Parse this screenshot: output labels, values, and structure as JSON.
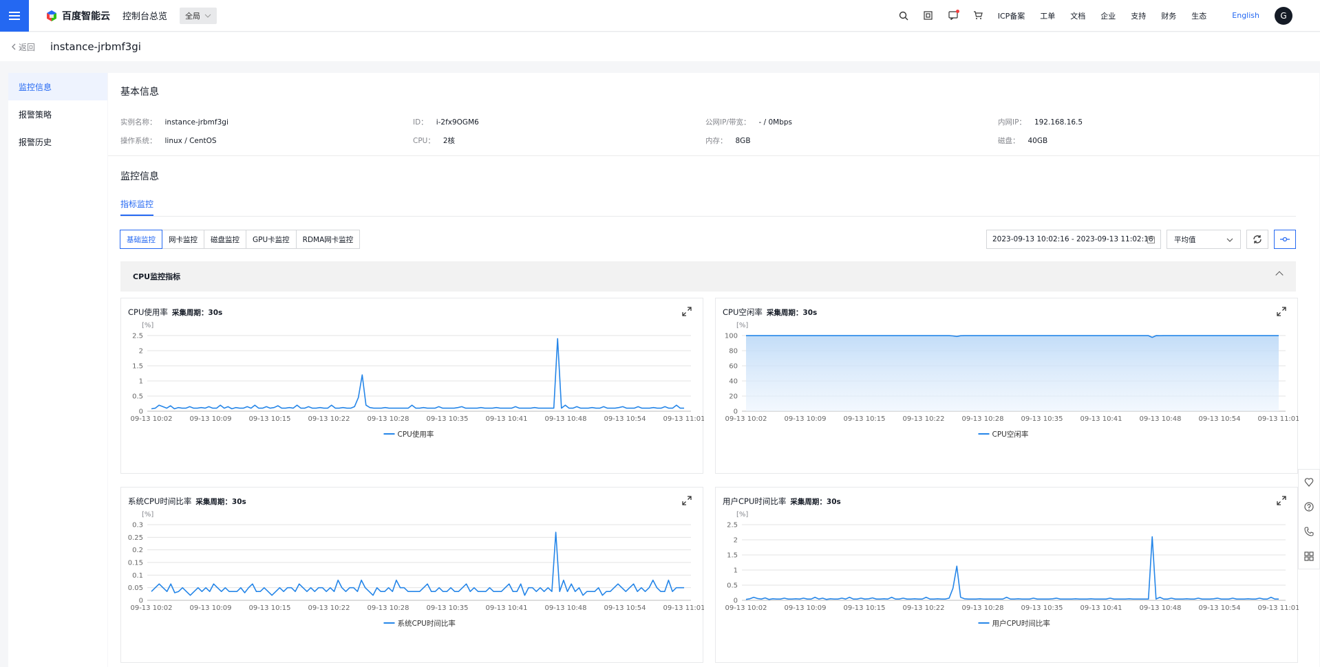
{
  "header": {
    "brand": "百度智能云",
    "console": "控制台总览",
    "region": "全局",
    "links": [
      "ICP备案",
      "工单",
      "文档",
      "企业",
      "支持",
      "财务",
      "生态"
    ],
    "language": "English",
    "avatar_letter": "G"
  },
  "subbar": {
    "back": "返回",
    "instance_name": "instance-jrbmf3gi"
  },
  "sidebar": {
    "items": [
      "监控信息",
      "报警策略",
      "报警历史"
    ]
  },
  "basic": {
    "title": "基本信息",
    "row1": [
      {
        "k": "实例名称：",
        "v": "instance-jrbmf3gi"
      },
      {
        "k": "ID：",
        "v": "i-2fx9OGM6"
      },
      {
        "k": "公网IP/带宽：",
        "v": "- / 0Mbps"
      },
      {
        "k": "内网IP：",
        "v": "192.168.16.5"
      }
    ],
    "row2": [
      {
        "k": "操作系统：",
        "v": "linux / CentOS"
      },
      {
        "k": "CPU：",
        "v": "2核"
      },
      {
        "k": "内存：",
        "v": "8GB"
      },
      {
        "k": "磁盘：",
        "v": "40GB"
      }
    ]
  },
  "monitor": {
    "title": "监控信息",
    "tab": "指标监控",
    "buttons": [
      "基础监控",
      "网卡监控",
      "磁盘监控",
      "GPU卡监控",
      "RDMA网卡监控"
    ],
    "date_range": "2023-09-13 10:02:16 - 2023-09-13 11:02:16",
    "aggregate": "平均值",
    "group_title": "CPU监控指标"
  },
  "chart_data": [
    {
      "type": "line",
      "title": "CPU使用率",
      "period_label": "采集周期：30s",
      "unit": "[%]",
      "legend": "CPU使用率",
      "ylim": [
        0,
        2.5
      ],
      "yticks": [
        "0",
        "0.5",
        "1",
        "1.5",
        "2",
        "2.5"
      ],
      "xticks": [
        "09-13 10:02",
        "09-13 10:09",
        "09-13 10:15",
        "09-13 10:22",
        "09-13 10:28",
        "09-13 10:35",
        "09-13 10:41",
        "09-13 10:48",
        "09-13 10:54",
        "09-13 11:01"
      ],
      "area": false,
      "values": [
        0.08,
        0.1,
        0.2,
        0.15,
        0.1,
        0.18,
        0.08,
        0.12,
        0.1,
        0.1,
        0.15,
        0.1,
        0.1,
        0.12,
        0.1,
        0.15,
        0.1,
        0.1,
        0.2,
        0.1,
        0.15,
        0.08,
        0.12,
        0.1,
        0.1,
        0.15,
        0.1,
        0.2,
        0.1,
        0.1,
        0.15,
        0.1,
        0.12,
        0.18,
        0.1,
        0.1,
        0.12,
        0.1,
        0.2,
        0.1,
        0.1,
        0.15,
        0.1,
        0.1,
        0.12,
        0.1,
        0.1,
        0.2,
        0.1,
        0.1,
        0.12,
        0.1,
        0.1,
        0.15,
        0.45,
        1.2,
        0.2,
        0.12,
        0.1,
        0.1,
        0.1,
        0.12,
        0.1,
        0.1,
        0.1,
        0.1,
        0.1,
        0.1,
        0.2,
        0.1,
        0.1,
        0.12,
        0.1,
        0.1,
        0.1,
        0.15,
        0.1,
        0.1,
        0.1,
        0.1,
        0.12,
        0.15,
        0.1,
        0.1,
        0.1,
        0.1,
        0.12,
        0.1,
        0.1,
        0.1,
        0.12,
        0.1,
        0.1,
        0.1,
        0.1,
        0.15,
        0.1,
        0.1,
        0.1,
        0.1,
        0.12,
        0.1,
        0.1,
        0.1,
        0.1,
        0.1,
        2.4,
        0.1,
        0.2,
        0.1,
        0.1,
        0.15,
        0.1,
        0.1,
        0.1,
        0.12,
        0.1,
        0.1,
        0.15,
        0.1,
        0.1,
        0.1,
        0.12,
        0.15,
        0.1,
        0.1,
        0.1,
        0.15,
        0.1,
        0.1,
        0.1,
        0.12,
        0.1,
        0.1,
        0.15,
        0.1,
        0.1,
        0.2,
        0.1,
        0.1
      ]
    },
    {
      "type": "area",
      "title": "CPU空闲率",
      "period_label": "采集周期：30s",
      "unit": "[%]",
      "legend": "CPU空闲率",
      "ylim": [
        0,
        100
      ],
      "yticks": [
        "0",
        "20",
        "40",
        "60",
        "80",
        "100"
      ],
      "xticks": [
        "09-13 10:02",
        "09-13 10:09",
        "09-13 10:15",
        "09-13 10:22",
        "09-13 10:28",
        "09-13 10:35",
        "09-13 10:41",
        "09-13 10:48",
        "09-13 10:54",
        "09-13 11:01"
      ],
      "area": true,
      "values": [
        99.9,
        99.9,
        99.9,
        99.9,
        99.9,
        99.9,
        99.9,
        99.9,
        99.9,
        99.9,
        99.9,
        99.9,
        99.9,
        99.9,
        99.9,
        99.9,
        99.9,
        99.9,
        99.9,
        99.9,
        99.9,
        99.9,
        99.9,
        99.9,
        99.9,
        99.9,
        99.9,
        99.9,
        99.9,
        99.9,
        99.9,
        99.9,
        99.9,
        99.9,
        99.9,
        99.9,
        99.9,
        99.9,
        99.9,
        99.9,
        99.9,
        99.9,
        99.9,
        99.9,
        99.9,
        99.9,
        99.9,
        99.9,
        99.9,
        99.9,
        99.9,
        99.9,
        99.9,
        99.9,
        99.5,
        98.8,
        99.8,
        99.9,
        99.9,
        99.9,
        99.9,
        99.9,
        99.9,
        99.9,
        99.9,
        99.9,
        99.9,
        99.9,
        99.9,
        99.9,
        99.9,
        99.9,
        99.9,
        99.9,
        99.9,
        99.9,
        99.9,
        99.9,
        99.9,
        99.9,
        99.9,
        99.9,
        99.9,
        99.9,
        99.9,
        99.9,
        99.9,
        99.9,
        99.9,
        99.9,
        99.9,
        99.9,
        99.9,
        99.9,
        99.9,
        99.9,
        99.9,
        99.9,
        99.9,
        99.9,
        99.9,
        99.9,
        99.9,
        99.9,
        99.9,
        99.9,
        97.6,
        99.9,
        99.8,
        99.9,
        99.9,
        99.9,
        99.9,
        99.9,
        99.9,
        99.9,
        99.9,
        99.9,
        99.9,
        99.9,
        99.9,
        99.9,
        99.9,
        99.9,
        99.9,
        99.9,
        99.9,
        99.9,
        99.9,
        99.9,
        99.9,
        99.9,
        99.9,
        99.9,
        99.9,
        99.9,
        99.9,
        99.9,
        99.9,
        99.9
      ]
    },
    {
      "type": "line",
      "title": "系统CPU时间比率",
      "period_label": "采集周期：30s",
      "unit": "[%]",
      "legend": "系统CPU时间比率",
      "ylim": [
        0,
        0.3
      ],
      "yticks": [
        "0",
        "0.05",
        "0.1",
        "0.15",
        "0.2",
        "0.25",
        "0.3"
      ],
      "xticks": [
        "09-13 10:02",
        "09-13 10:09",
        "09-13 10:15",
        "09-13 10:22",
        "09-13 10:28",
        "09-13 10:35",
        "09-13 10:41",
        "09-13 10:48",
        "09-13 10:54",
        "09-13 11:01"
      ],
      "area": false,
      "values": [
        0.035,
        0.05,
        0.065,
        0.05,
        0.035,
        0.065,
        0.03,
        0.035,
        0.05,
        0.035,
        0.02,
        0.035,
        0.05,
        0.035,
        0.05,
        0.035,
        0.065,
        0.05,
        0.035,
        0.05,
        0.035,
        0.035,
        0.035,
        0.05,
        0.03,
        0.05,
        0.065,
        0.035,
        0.035,
        0.05,
        0.035,
        0.02,
        0.035,
        0.05,
        0.035,
        0.05,
        0.05,
        0.035,
        0.065,
        0.05,
        0.035,
        0.05,
        0.035,
        0.05,
        0.05,
        0.035,
        0.05,
        0.035,
        0.08,
        0.05,
        0.035,
        0.05,
        0.05,
        0.035,
        0.08,
        0.05,
        0.035,
        0.02,
        0.05,
        0.035,
        0.035,
        0.05,
        0.035,
        0.08,
        0.05,
        0.05,
        0.035,
        0.035,
        0.035,
        0.035,
        0.05,
        0.065,
        0.035,
        0.035,
        0.05,
        0.035,
        0.035,
        0.05,
        0.035,
        0.035,
        0.05,
        0.065,
        0.035,
        0.05,
        0.035,
        0.035,
        0.035,
        0.05,
        0.035,
        0.035,
        0.035,
        0.05,
        0.065,
        0.035,
        0.035,
        0.065,
        0.02,
        0.05,
        0.05,
        0.035,
        0.05,
        0.035,
        0.05,
        0.035,
        0.27,
        0.035,
        0.08,
        0.035,
        0.065,
        0.035,
        0.05,
        0.02,
        0.035,
        0.035,
        0.035,
        0.05,
        0.02,
        0.035,
        0.035,
        0.05,
        0.065,
        0.05,
        0.035,
        0.05,
        0.065,
        0.035,
        0.05,
        0.035,
        0.05,
        0.08,
        0.05,
        0.035,
        0.035,
        0.08,
        0.035,
        0.05,
        0.05,
        0.05
      ]
    },
    {
      "type": "line",
      "title": "用户CPU时间比率",
      "period_label": "采集周期：30s",
      "unit": "[%]",
      "legend": "用户CPU时间比率",
      "ylim": [
        0,
        2.5
      ],
      "yticks": [
        "0",
        "0.5",
        "1",
        "1.5",
        "2",
        "2.5"
      ],
      "xticks": [
        "09-13 10:02",
        "09-13 10:09",
        "09-13 10:15",
        "09-13 10:22",
        "09-13 10:28",
        "09-13 10:35",
        "09-13 10:41",
        "09-13 10:48",
        "09-13 10:54",
        "09-13 11:01"
      ],
      "area": false,
      "values": [
        0.03,
        0.05,
        0.1,
        0.06,
        0.04,
        0.08,
        0.03,
        0.05,
        0.04,
        0.04,
        0.07,
        0.04,
        0.04,
        0.05,
        0.04,
        0.07,
        0.04,
        0.04,
        0.1,
        0.04,
        0.07,
        0.03,
        0.05,
        0.04,
        0.04,
        0.07,
        0.04,
        0.1,
        0.04,
        0.04,
        0.07,
        0.04,
        0.05,
        0.08,
        0.04,
        0.04,
        0.05,
        0.04,
        0.1,
        0.04,
        0.04,
        0.07,
        0.04,
        0.04,
        0.05,
        0.04,
        0.04,
        0.1,
        0.04,
        0.04,
        0.05,
        0.04,
        0.04,
        0.07,
        0.4,
        1.13,
        0.1,
        0.05,
        0.04,
        0.04,
        0.04,
        0.05,
        0.04,
        0.04,
        0.04,
        0.04,
        0.04,
        0.04,
        0.1,
        0.04,
        0.04,
        0.05,
        0.04,
        0.04,
        0.04,
        0.07,
        0.04,
        0.04,
        0.04,
        0.04,
        0.05,
        0.07,
        0.04,
        0.04,
        0.04,
        0.04,
        0.05,
        0.04,
        0.04,
        0.04,
        0.05,
        0.04,
        0.04,
        0.04,
        0.04,
        0.07,
        0.04,
        0.04,
        0.04,
        0.04,
        0.05,
        0.04,
        0.04,
        0.04,
        0.04,
        0.04,
        2.1,
        0.04,
        0.1,
        0.04,
        0.04,
        0.07,
        0.04,
        0.04,
        0.04,
        0.05,
        0.04,
        0.04,
        0.07,
        0.04,
        0.04,
        0.04,
        0.05,
        0.07,
        0.04,
        0.04,
        0.04,
        0.07,
        0.04,
        0.04,
        0.04,
        0.05,
        0.04,
        0.04,
        0.07,
        0.04,
        0.04,
        0.1,
        0.04,
        0.04
      ]
    }
  ],
  "colors": {
    "accent": "#2468f2",
    "line": "#2485e8"
  }
}
